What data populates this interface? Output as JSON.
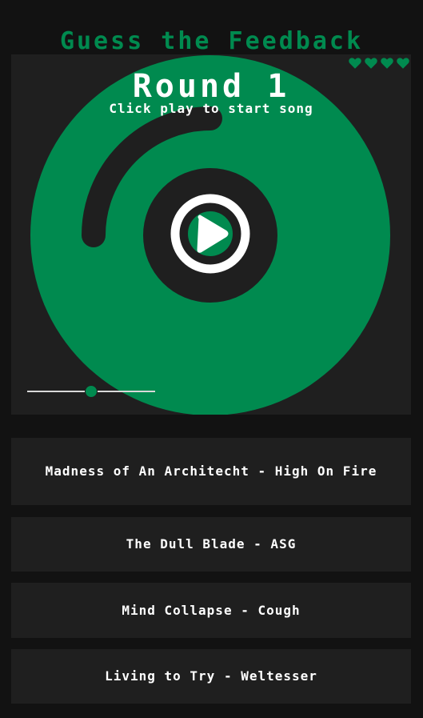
{
  "app": {
    "title": "Guess the Feedback",
    "accent_color": "#008a4f",
    "background_color": "#121212",
    "panel_color": "#1f1f1f"
  },
  "lives": {
    "count": 4,
    "icon": "heart-icon"
  },
  "round": {
    "title": "Round 1",
    "subtitle": "Click play to start song"
  },
  "player": {
    "play_icon": "play-icon",
    "progress_fraction": 0.25,
    "volume_fraction": 0.5
  },
  "answers": [
    {
      "label": "Madness of An Architecht - High On Fire"
    },
    {
      "label": "The Dull Blade - ASG"
    },
    {
      "label": "Mind Collapse - Cough"
    },
    {
      "label": "Living to Try - Weltesser"
    }
  ]
}
